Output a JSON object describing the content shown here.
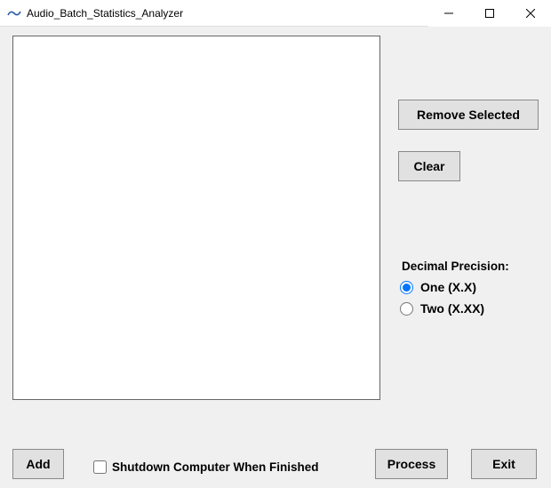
{
  "window": {
    "title": "Audio_Batch_Statistics_Analyzer"
  },
  "list": {
    "items": []
  },
  "buttons": {
    "remove_selected": "Remove Selected",
    "clear": "Clear",
    "add": "Add",
    "process": "Process",
    "exit": "Exit"
  },
  "precision": {
    "label": "Decimal Precision:",
    "options": {
      "one": "One (X.X)",
      "two": "Two (X.XX)"
    },
    "selected": "one"
  },
  "shutdown": {
    "label": "Shutdown Computer When Finished",
    "checked": false
  },
  "icons": {
    "app": "app-icon",
    "minimize": "minimize-icon",
    "maximize": "maximize-icon",
    "close": "close-icon"
  }
}
